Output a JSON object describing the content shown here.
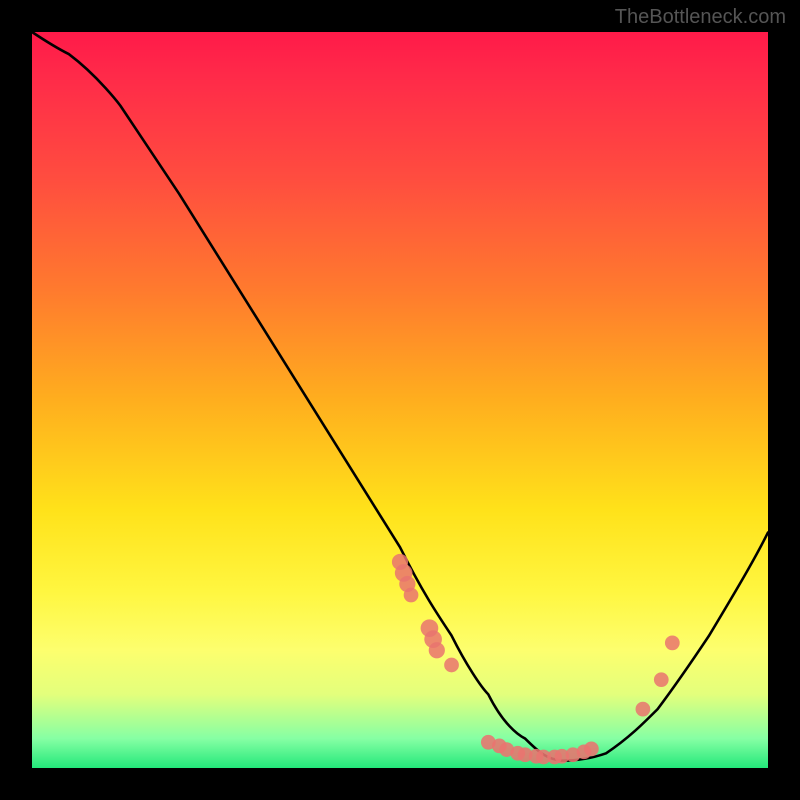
{
  "watermark": "TheBottleneck.com",
  "chart_data": {
    "type": "line",
    "title": "",
    "xlabel": "",
    "ylabel": "",
    "xlim": [
      0,
      100
    ],
    "ylim": [
      0,
      100
    ],
    "series": [
      {
        "name": "bottleneck-curve",
        "x": [
          0,
          5,
          12,
          20,
          30,
          40,
          50,
          57,
          62,
          67,
          72,
          78,
          85,
          92,
          100
        ],
        "values": [
          100,
          97,
          90,
          78,
          62,
          46,
          30,
          18,
          10,
          4,
          1,
          2,
          8,
          18,
          32
        ]
      }
    ],
    "markers": {
      "cluster_left": {
        "x_range": [
          50,
          57
        ],
        "y_range": [
          14,
          28
        ],
        "count": 8
      },
      "cluster_bottom": {
        "x_range": [
          62,
          76
        ],
        "y_range": [
          1,
          4
        ],
        "count": 12
      },
      "cluster_right": {
        "x_range": [
          83,
          87
        ],
        "y_range": [
          8,
          17
        ],
        "count": 3
      }
    },
    "gradient_stops": [
      {
        "pos": 0.0,
        "color": "#ff1a49"
      },
      {
        "pos": 0.35,
        "color": "#ff7a2e"
      },
      {
        "pos": 0.65,
        "color": "#ffe21a"
      },
      {
        "pos": 0.9,
        "color": "#e3ff7c"
      },
      {
        "pos": 1.0,
        "color": "#23e87a"
      }
    ]
  }
}
